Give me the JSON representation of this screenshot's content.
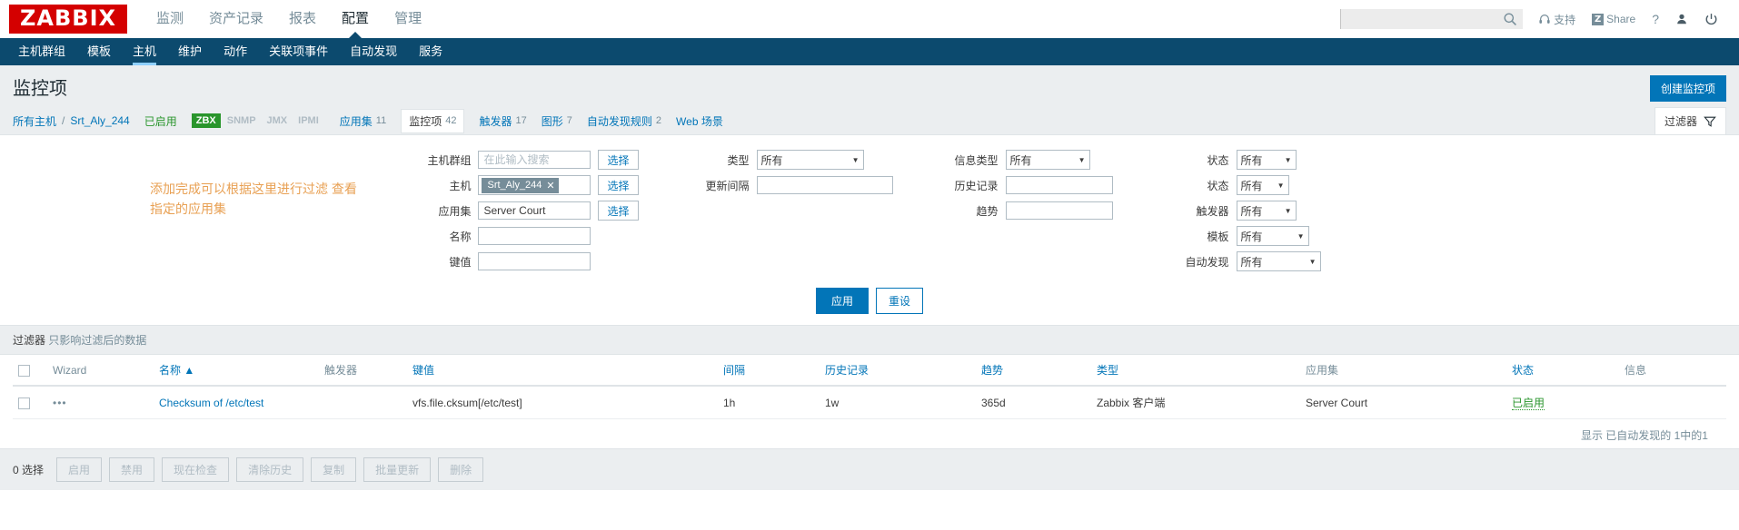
{
  "header": {
    "logo": "ZABBIX",
    "menu": [
      {
        "label": "监测",
        "active": false
      },
      {
        "label": "资产记录",
        "active": false
      },
      {
        "label": "报表",
        "active": false
      },
      {
        "label": "配置",
        "active": true
      },
      {
        "label": "管理",
        "active": false
      }
    ],
    "search": {
      "value": "",
      "placeholder": ""
    },
    "support_label": "支持",
    "share_label": "Share",
    "share_badge": "Z",
    "help_label": "?"
  },
  "submenu": [
    {
      "label": "主机群组",
      "active": false
    },
    {
      "label": "模板",
      "active": false
    },
    {
      "label": "主机",
      "active": true
    },
    {
      "label": "维护",
      "active": false
    },
    {
      "label": "动作",
      "active": false
    },
    {
      "label": "关联项事件",
      "active": false
    },
    {
      "label": "自动发现",
      "active": false
    },
    {
      "label": "服务",
      "active": false
    }
  ],
  "page": {
    "title": "监控项",
    "create_button": "创建监控项"
  },
  "breadcrumb": {
    "all_hosts": "所有主机",
    "separator": "/",
    "host": "Srt_Aly_244",
    "status": "已启用",
    "protocols": [
      {
        "label": "ZBX",
        "enabled": true
      },
      {
        "label": "SNMP",
        "enabled": false
      },
      {
        "label": "JMX",
        "enabled": false
      },
      {
        "label": "IPMI",
        "enabled": false
      }
    ],
    "links": [
      {
        "label": "应用集",
        "count": "11",
        "selected": false
      },
      {
        "label": "监控项",
        "count": "42",
        "selected": true
      },
      {
        "label": "触发器",
        "count": "17",
        "selected": false
      },
      {
        "label": "图形",
        "count": "7",
        "selected": false
      },
      {
        "label": "自动发现规则",
        "count": "2",
        "selected": false
      },
      {
        "label": "Web 场景",
        "count": "",
        "selected": false
      }
    ],
    "filter_toggle": "过滤器"
  },
  "annotation": "添加完成可以根据这里进行过滤 查看指定的应用集",
  "filter": {
    "col1": [
      {
        "label": "主机群组",
        "type": "text",
        "value": "",
        "placeholder": "在此输入搜索",
        "button": "选择"
      },
      {
        "label": "主机",
        "type": "chip",
        "chip": "Srt_Aly_244",
        "button": "选择"
      },
      {
        "label": "应用集",
        "type": "text",
        "value": "Server Court",
        "placeholder": "",
        "button": "选择"
      },
      {
        "label": "名称",
        "type": "text",
        "value": "",
        "placeholder": "",
        "button": ""
      },
      {
        "label": "键值",
        "type": "text",
        "value": "",
        "placeholder": "",
        "button": ""
      }
    ],
    "col2": [
      {
        "label": "类型",
        "type": "select",
        "value": "所有"
      },
      {
        "label": "更新间隔",
        "type": "text",
        "value": ""
      }
    ],
    "col3": [
      {
        "label": "信息类型",
        "type": "select",
        "value": "所有"
      },
      {
        "label": "历史记录",
        "type": "text",
        "value": ""
      },
      {
        "label": "趋势",
        "type": "text",
        "value": ""
      }
    ],
    "col4": [
      {
        "label": "状态",
        "type": "select",
        "value": "所有"
      },
      {
        "label": "状态",
        "type": "select",
        "value": "所有"
      },
      {
        "label": "触发器",
        "type": "select",
        "value": "所有"
      },
      {
        "label": "模板",
        "type": "select",
        "value": "所有"
      },
      {
        "label": "自动发现",
        "type": "select",
        "value": "所有"
      }
    ],
    "apply_button": "应用",
    "reset_button": "重设",
    "note_bold": "过滤器",
    "note_rest": "只影响过滤后的数据"
  },
  "table": {
    "columns": [
      {
        "label": "Wizard",
        "link": false
      },
      {
        "label": "名称 ▲",
        "link": true
      },
      {
        "label": "触发器",
        "link": false
      },
      {
        "label": "键值",
        "link": true
      },
      {
        "label": "间隔",
        "link": true
      },
      {
        "label": "历史记录",
        "link": true
      },
      {
        "label": "趋势",
        "link": true
      },
      {
        "label": "类型",
        "link": true
      },
      {
        "label": "应用集",
        "link": false
      },
      {
        "label": "状态",
        "link": true
      },
      {
        "label": "信息",
        "link": false
      }
    ],
    "rows": [
      {
        "wizard": "•••",
        "name": "Checksum of /etc/test",
        "triggers": "",
        "key": "vfs.file.cksum[/etc/test]",
        "interval": "1h",
        "history": "1w",
        "trends": "365d",
        "type": "Zabbix 客户端",
        "application": "Server Court",
        "status": "已启用",
        "info": ""
      }
    ],
    "result_text": "显示 已自动发现的 1中的1"
  },
  "footer": {
    "selected": "0 选择",
    "buttons": [
      "启用",
      "禁用",
      "现在检查",
      "清除历史",
      "复制",
      "批量更新",
      "删除"
    ]
  },
  "colors": {
    "brand_red": "#d40000",
    "nav_blue": "#0c4a6e",
    "accent_blue": "#0275b8",
    "green": "#29952c",
    "annotation_orange": "#e8a053"
  }
}
